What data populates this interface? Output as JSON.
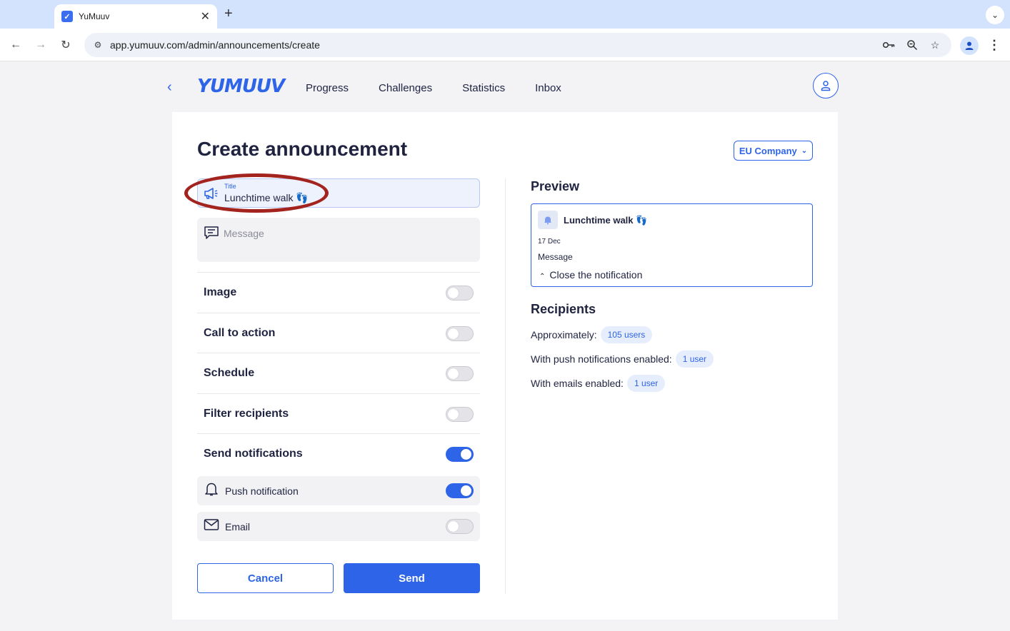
{
  "browser": {
    "tab_title": "YuMuuv",
    "favicon_glyph": "✓",
    "url": "app.yumuuv.com/admin/announcements/create"
  },
  "app": {
    "logo": "YUMUUV",
    "nav": [
      "Progress",
      "Challenges",
      "Statistics",
      "Inbox"
    ]
  },
  "page": {
    "title": "Create announcement",
    "company": "EU Company"
  },
  "form": {
    "title_label": "Title",
    "title_value": "Lunchtime walk 👣",
    "message_placeholder": "Message",
    "toggles": [
      {
        "label": "Image",
        "on": false
      },
      {
        "label": "Call to action",
        "on": false
      },
      {
        "label": "Schedule",
        "on": false
      },
      {
        "label": "Filter recipients",
        "on": false
      },
      {
        "label": "Send notifications",
        "on": true
      }
    ],
    "push_label": "Push notification",
    "push_on": true,
    "email_label": "Email",
    "email_on": false,
    "cancel_label": "Cancel",
    "send_label": "Send"
  },
  "preview": {
    "heading": "Preview",
    "title": "Lunchtime walk 👣",
    "date": "17 Dec",
    "message": "Message",
    "close_label": "Close the notification"
  },
  "recipients": {
    "heading": "Recipients",
    "approx_label": "Approximately:",
    "approx_value": "105 users",
    "push_label": "With push notifications enabled:",
    "push_value": "1 user",
    "email_label": "With emails enabled:",
    "email_value": "1 user"
  },
  "colors": {
    "accent": "#2e64e8",
    "annotation": "#a3231e"
  }
}
